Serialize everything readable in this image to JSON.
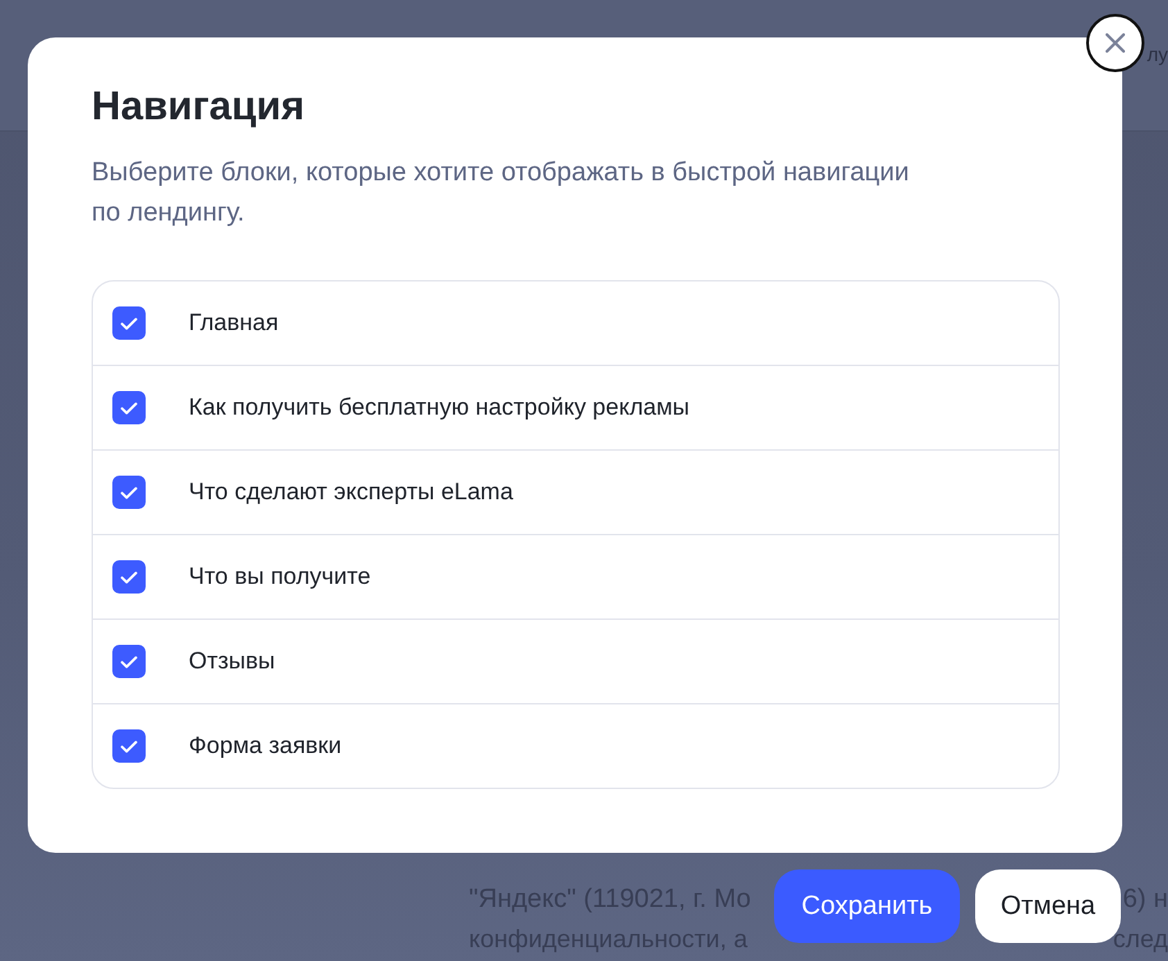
{
  "background_page": {
    "header_text": "лу",
    "legal_text_lines": [
      {
        "left": "\"Яндекс\" (119021, г. Мо",
        "right": "6) н"
      },
      {
        "left": "конфиденциальности, а",
        "right": "след"
      }
    ]
  },
  "dialog": {
    "title": "Навигация",
    "description": "Выберите блоки, которые хотите отображать в быстрой навигации по лендингу.",
    "items": [
      {
        "label": "Главная",
        "checked": true
      },
      {
        "label": "Как получить бесплатную настройку рекламы",
        "checked": true
      },
      {
        "label": "Что сделают эксперты eLama",
        "checked": true
      },
      {
        "label": "Что вы получите",
        "checked": true
      },
      {
        "label": "Отзывы",
        "checked": true
      },
      {
        "label": "Форма заявки",
        "checked": true
      }
    ]
  },
  "buttons": [
    {
      "label": "Сохранить",
      "kind": "primary"
    },
    {
      "label": "Отмена",
      "kind": "secondary"
    }
  ]
}
